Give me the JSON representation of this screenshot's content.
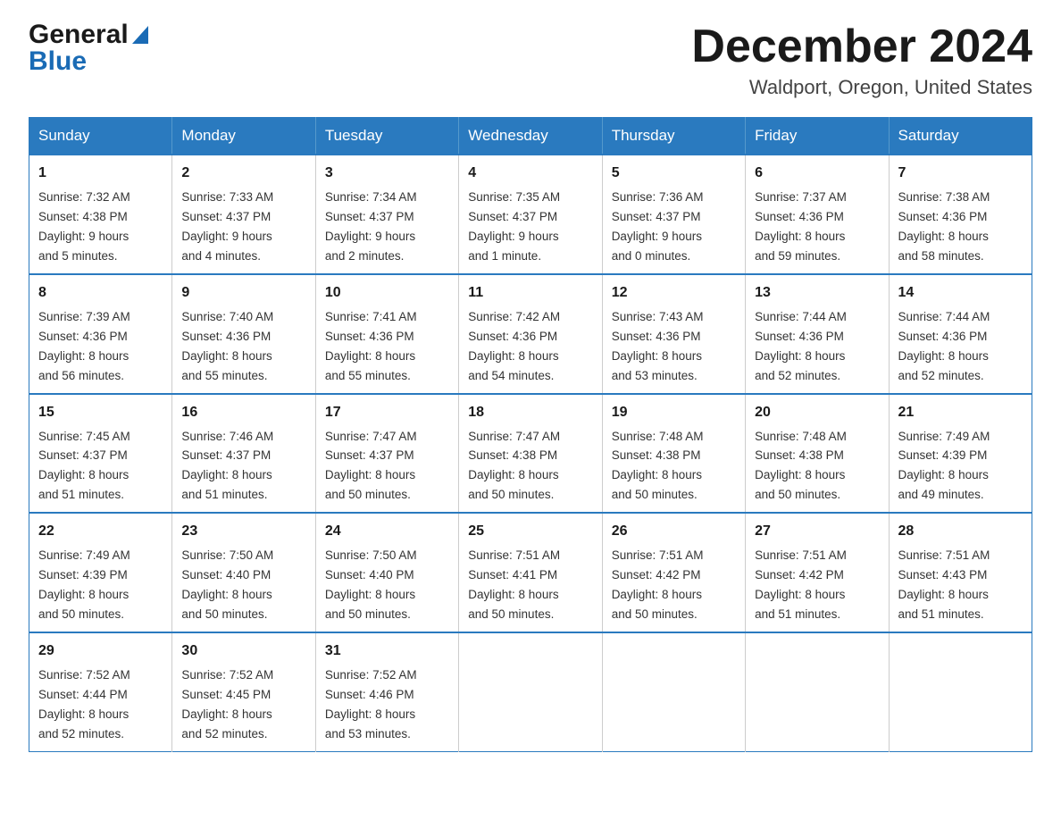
{
  "logo": {
    "general": "General",
    "blue": "Blue"
  },
  "title": "December 2024",
  "location": "Waldport, Oregon, United States",
  "weekdays": [
    "Sunday",
    "Monday",
    "Tuesday",
    "Wednesday",
    "Thursday",
    "Friday",
    "Saturday"
  ],
  "weeks": [
    [
      {
        "day": "1",
        "sunrise": "7:32 AM",
        "sunset": "4:38 PM",
        "daylight_hours": "9",
        "daylight_minutes": "5"
      },
      {
        "day": "2",
        "sunrise": "7:33 AM",
        "sunset": "4:37 PM",
        "daylight_hours": "9",
        "daylight_minutes": "4"
      },
      {
        "day": "3",
        "sunrise": "7:34 AM",
        "sunset": "4:37 PM",
        "daylight_hours": "9",
        "daylight_minutes": "2"
      },
      {
        "day": "4",
        "sunrise": "7:35 AM",
        "sunset": "4:37 PM",
        "daylight_hours": "9",
        "daylight_minutes": "1"
      },
      {
        "day": "5",
        "sunrise": "7:36 AM",
        "sunset": "4:37 PM",
        "daylight_hours": "9",
        "daylight_minutes": "0"
      },
      {
        "day": "6",
        "sunrise": "7:37 AM",
        "sunset": "4:36 PM",
        "daylight_hours": "8",
        "daylight_minutes": "59"
      },
      {
        "day": "7",
        "sunrise": "7:38 AM",
        "sunset": "4:36 PM",
        "daylight_hours": "8",
        "daylight_minutes": "58"
      }
    ],
    [
      {
        "day": "8",
        "sunrise": "7:39 AM",
        "sunset": "4:36 PM",
        "daylight_hours": "8",
        "daylight_minutes": "56"
      },
      {
        "day": "9",
        "sunrise": "7:40 AM",
        "sunset": "4:36 PM",
        "daylight_hours": "8",
        "daylight_minutes": "55"
      },
      {
        "day": "10",
        "sunrise": "7:41 AM",
        "sunset": "4:36 PM",
        "daylight_hours": "8",
        "daylight_minutes": "55"
      },
      {
        "day": "11",
        "sunrise": "7:42 AM",
        "sunset": "4:36 PM",
        "daylight_hours": "8",
        "daylight_minutes": "54"
      },
      {
        "day": "12",
        "sunrise": "7:43 AM",
        "sunset": "4:36 PM",
        "daylight_hours": "8",
        "daylight_minutes": "53"
      },
      {
        "day": "13",
        "sunrise": "7:44 AM",
        "sunset": "4:36 PM",
        "daylight_hours": "8",
        "daylight_minutes": "52"
      },
      {
        "day": "14",
        "sunrise": "7:44 AM",
        "sunset": "4:36 PM",
        "daylight_hours": "8",
        "daylight_minutes": "52"
      }
    ],
    [
      {
        "day": "15",
        "sunrise": "7:45 AM",
        "sunset": "4:37 PM",
        "daylight_hours": "8",
        "daylight_minutes": "51"
      },
      {
        "day": "16",
        "sunrise": "7:46 AM",
        "sunset": "4:37 PM",
        "daylight_hours": "8",
        "daylight_minutes": "51"
      },
      {
        "day": "17",
        "sunrise": "7:47 AM",
        "sunset": "4:37 PM",
        "daylight_hours": "8",
        "daylight_minutes": "50"
      },
      {
        "day": "18",
        "sunrise": "7:47 AM",
        "sunset": "4:38 PM",
        "daylight_hours": "8",
        "daylight_minutes": "50"
      },
      {
        "day": "19",
        "sunrise": "7:48 AM",
        "sunset": "4:38 PM",
        "daylight_hours": "8",
        "daylight_minutes": "50"
      },
      {
        "day": "20",
        "sunrise": "7:48 AM",
        "sunset": "4:38 PM",
        "daylight_hours": "8",
        "daylight_minutes": "50"
      },
      {
        "day": "21",
        "sunrise": "7:49 AM",
        "sunset": "4:39 PM",
        "daylight_hours": "8",
        "daylight_minutes": "49"
      }
    ],
    [
      {
        "day": "22",
        "sunrise": "7:49 AM",
        "sunset": "4:39 PM",
        "daylight_hours": "8",
        "daylight_minutes": "50"
      },
      {
        "day": "23",
        "sunrise": "7:50 AM",
        "sunset": "4:40 PM",
        "daylight_hours": "8",
        "daylight_minutes": "50"
      },
      {
        "day": "24",
        "sunrise": "7:50 AM",
        "sunset": "4:40 PM",
        "daylight_hours": "8",
        "daylight_minutes": "50"
      },
      {
        "day": "25",
        "sunrise": "7:51 AM",
        "sunset": "4:41 PM",
        "daylight_hours": "8",
        "daylight_minutes": "50"
      },
      {
        "day": "26",
        "sunrise": "7:51 AM",
        "sunset": "4:42 PM",
        "daylight_hours": "8",
        "daylight_minutes": "50"
      },
      {
        "day": "27",
        "sunrise": "7:51 AM",
        "sunset": "4:42 PM",
        "daylight_hours": "8",
        "daylight_minutes": "51"
      },
      {
        "day": "28",
        "sunrise": "7:51 AM",
        "sunset": "4:43 PM",
        "daylight_hours": "8",
        "daylight_minutes": "51"
      }
    ],
    [
      {
        "day": "29",
        "sunrise": "7:52 AM",
        "sunset": "4:44 PM",
        "daylight_hours": "8",
        "daylight_minutes": "52"
      },
      {
        "day": "30",
        "sunrise": "7:52 AM",
        "sunset": "4:45 PM",
        "daylight_hours": "8",
        "daylight_minutes": "52"
      },
      {
        "day": "31",
        "sunrise": "7:52 AM",
        "sunset": "4:46 PM",
        "daylight_hours": "8",
        "daylight_minutes": "53"
      },
      null,
      null,
      null,
      null
    ]
  ]
}
